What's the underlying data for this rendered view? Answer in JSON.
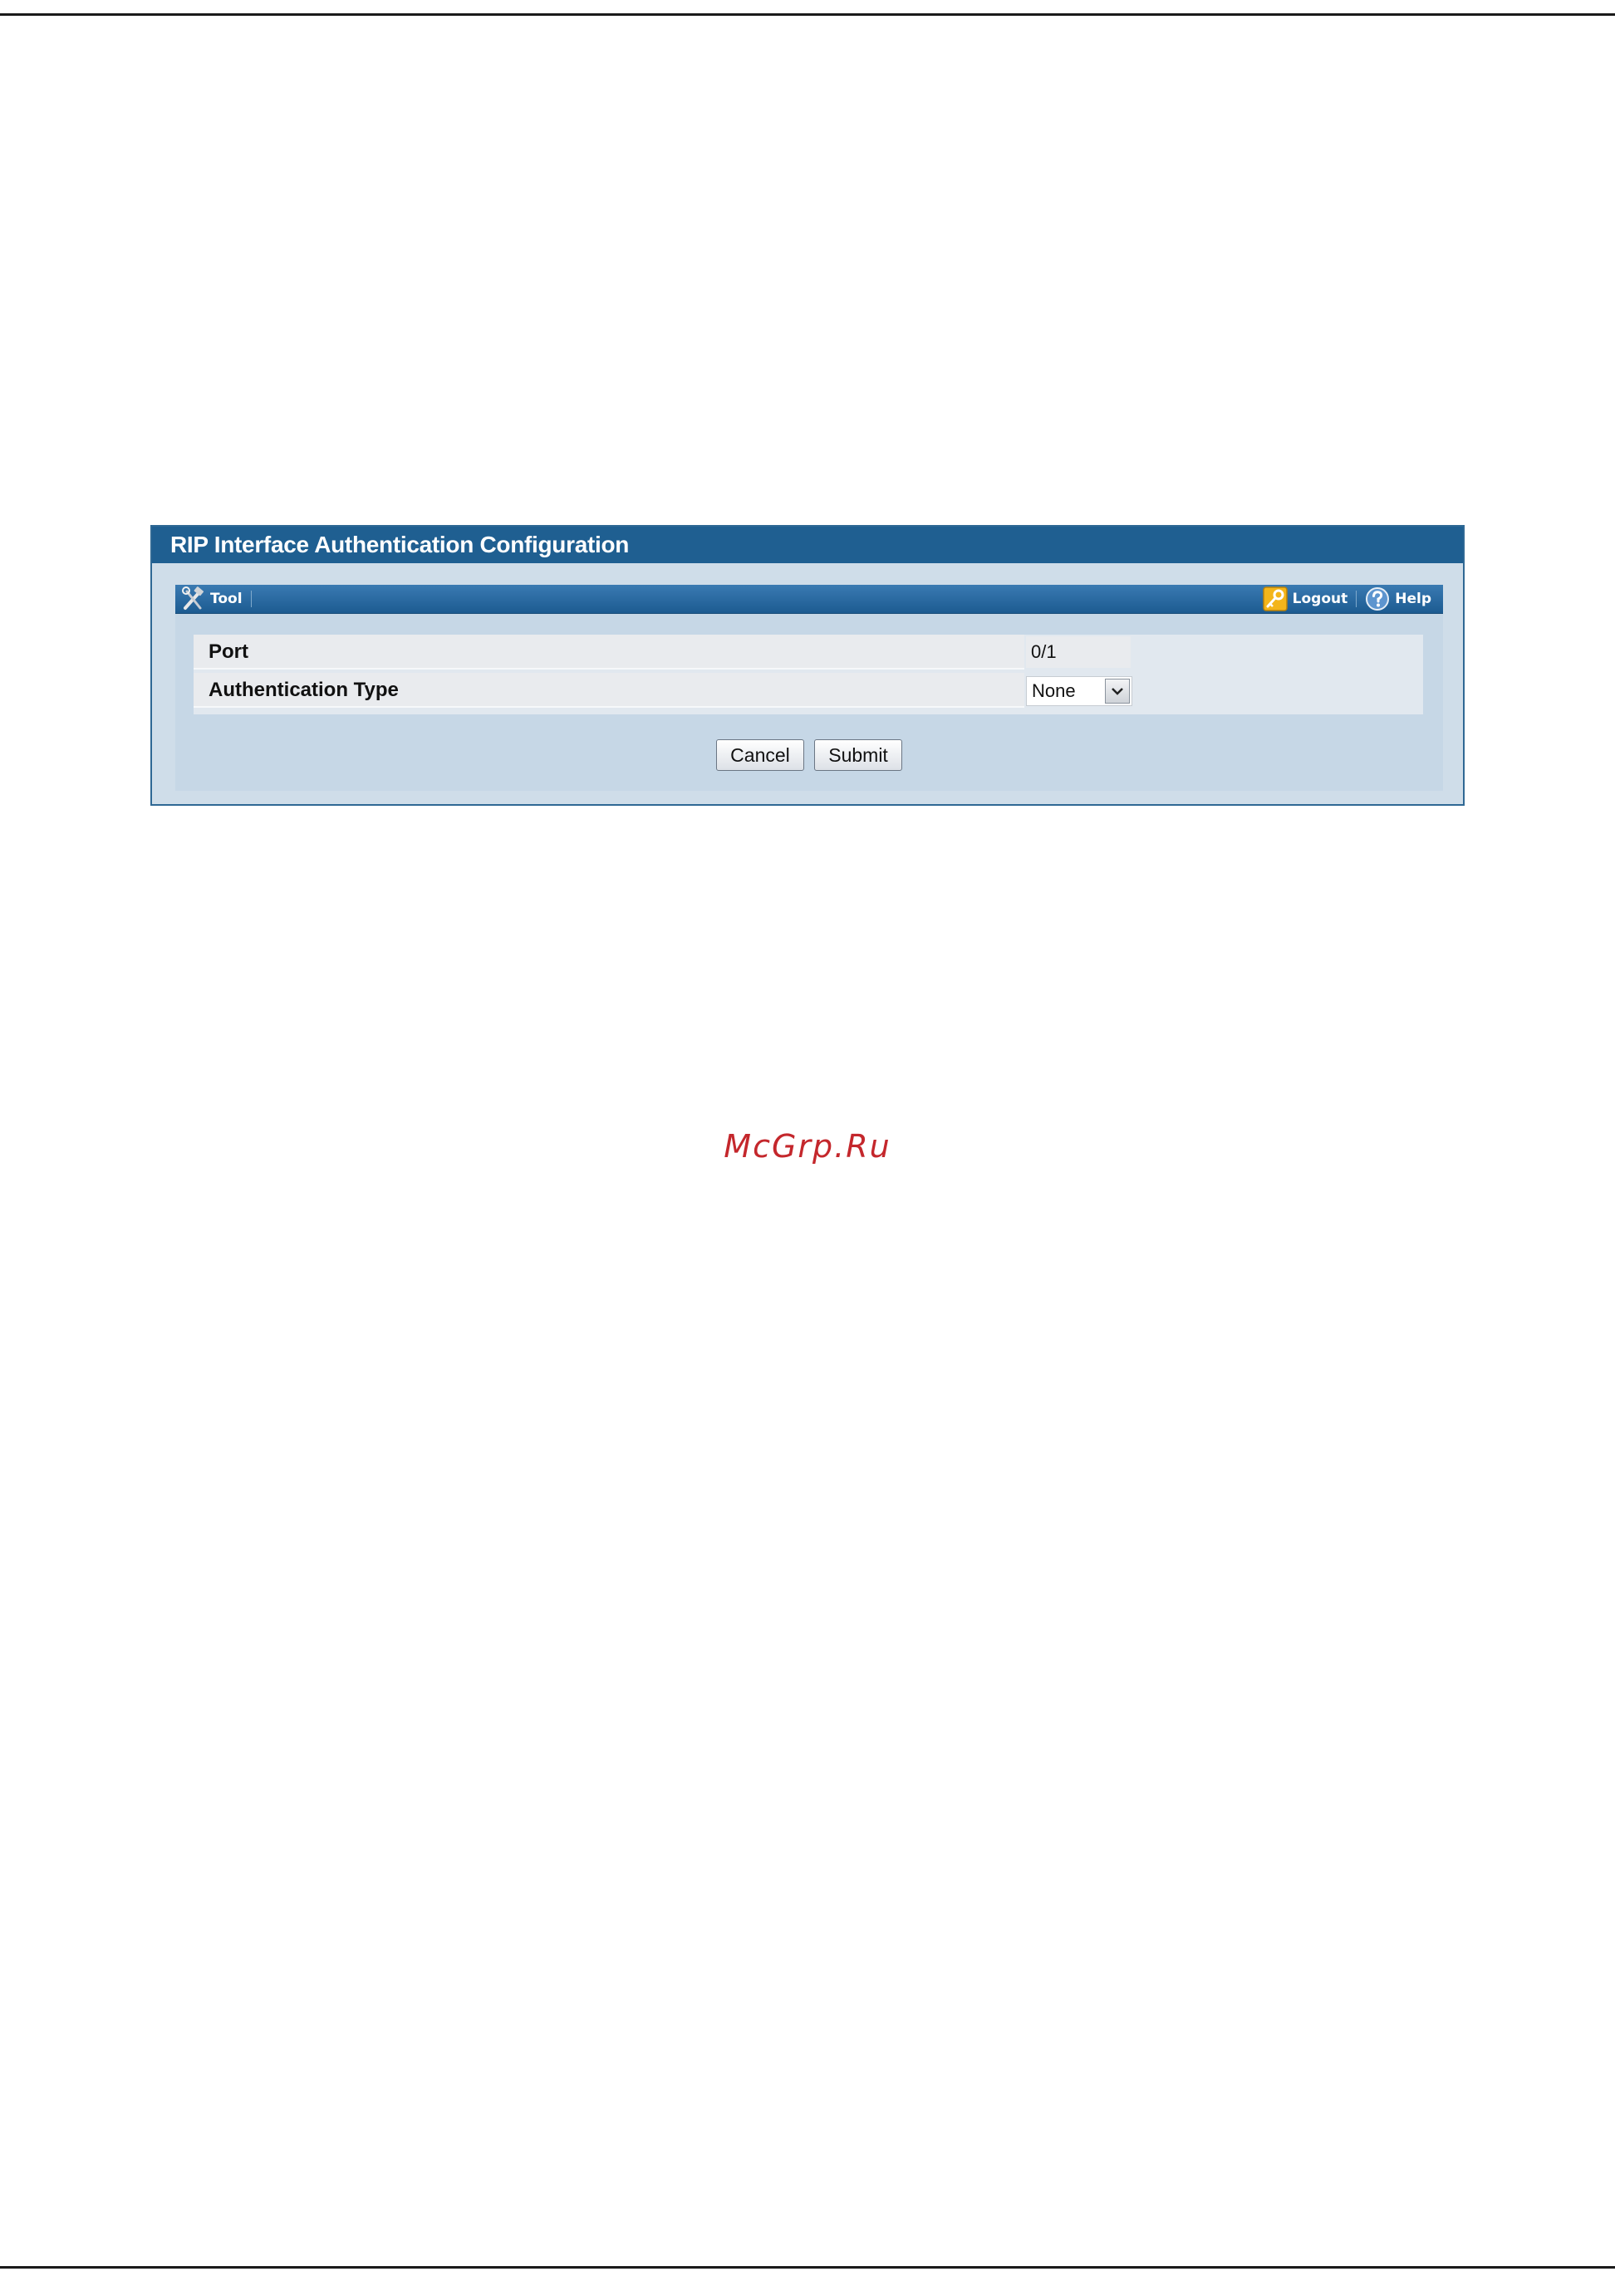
{
  "panel": {
    "title": "RIP Interface Authentication Configuration"
  },
  "toolbar": {
    "tool_label": "Tool",
    "logout_label": "Logout",
    "help_label": "Help"
  },
  "form": {
    "port": {
      "label": "Port",
      "value": "0/1"
    },
    "auth_type": {
      "label": "Authentication Type",
      "selected": "None"
    }
  },
  "buttons": {
    "cancel_label": "Cancel",
    "submit_label": "Submit"
  },
  "watermark": "McGrp.Ru",
  "icons": {
    "tool": "tools-icon",
    "logout": "key-icon",
    "help": "help-icon",
    "dropdown": "chevron-down-icon"
  },
  "colors": {
    "title_bar": "#1f5f91",
    "toolbar": "#2b6ba3",
    "panel_bg": "#cfdde9",
    "watermark": "#c4272c"
  }
}
